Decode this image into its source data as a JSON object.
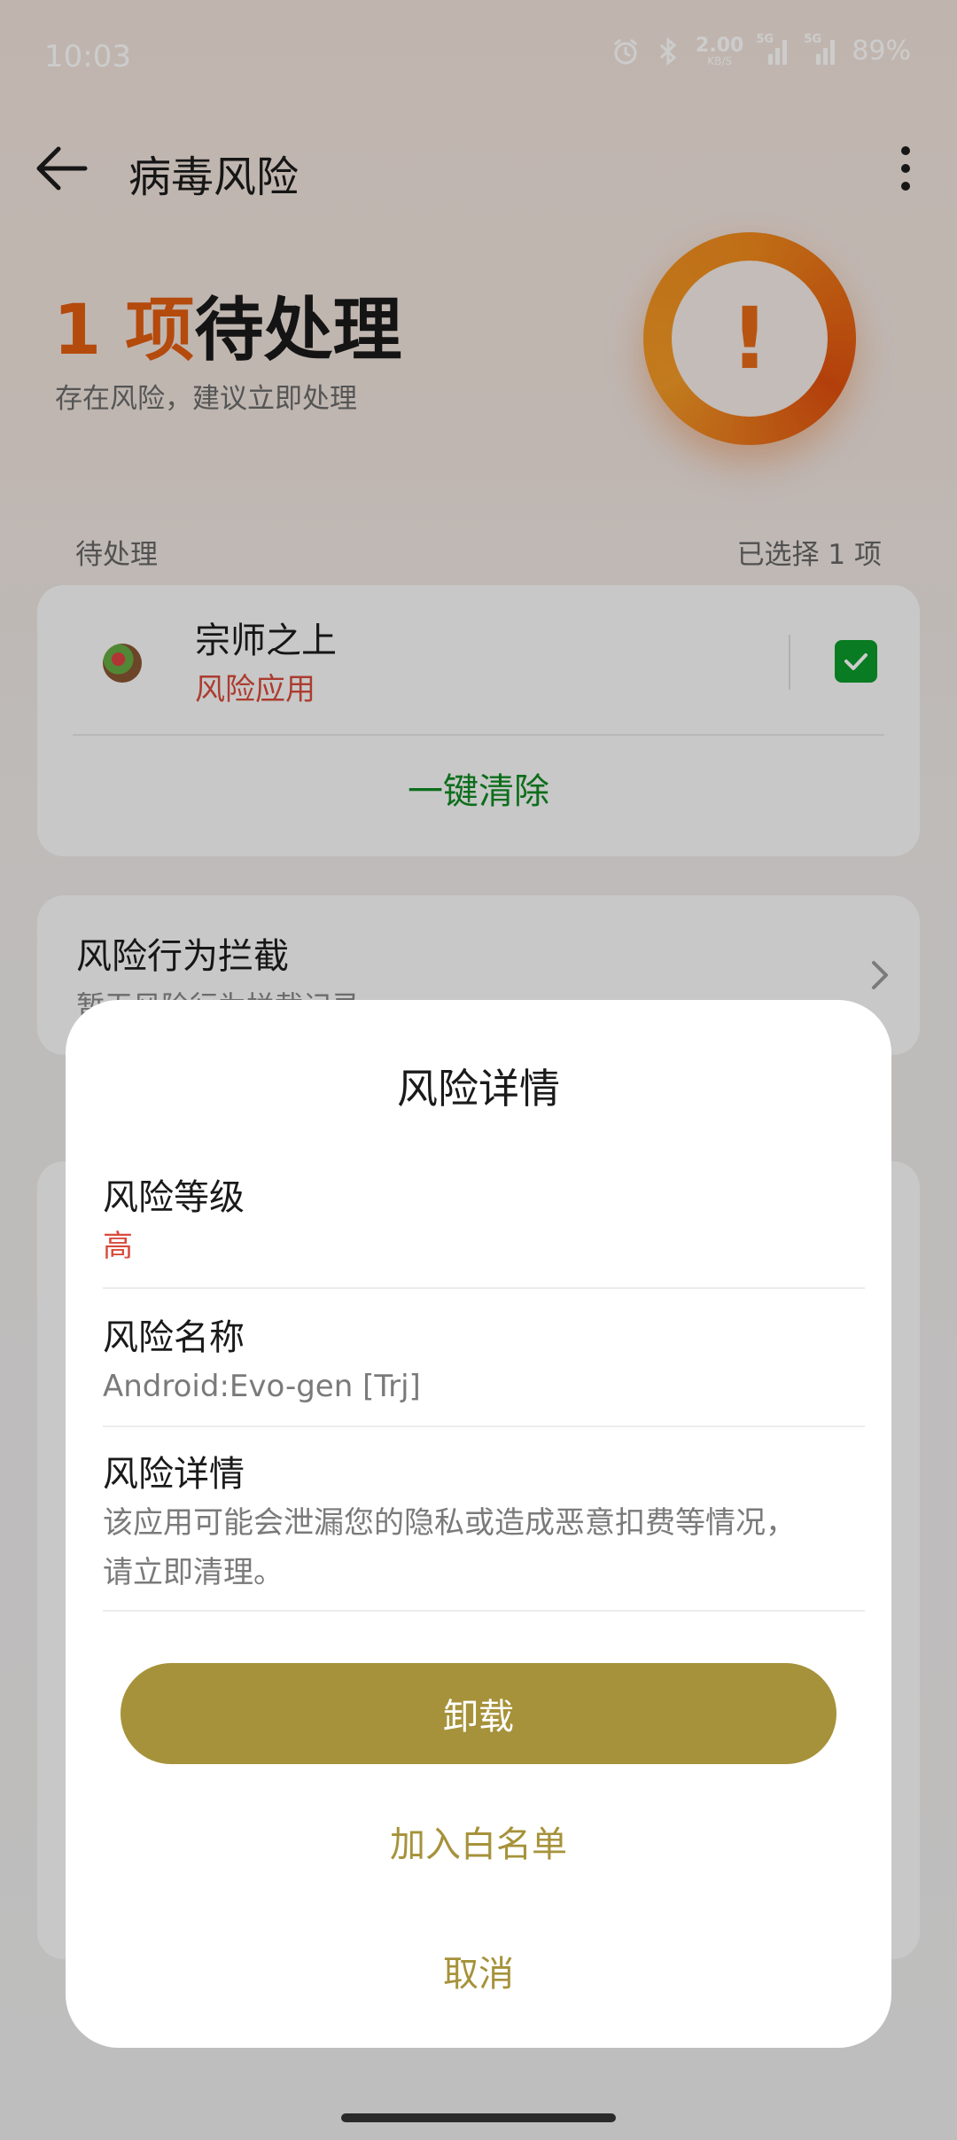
{
  "status_bar": {
    "time": "10:03",
    "net_speed_value": "2.00",
    "net_speed_unit": "KB/S",
    "network_tag_1": "5G",
    "network_tag_2": "5G",
    "battery": "89%",
    "icons": [
      "alarm-icon",
      "bluetooth-icon",
      "signal-icon",
      "signal-icon"
    ]
  },
  "header": {
    "title": "病毒风险"
  },
  "summary": {
    "count": "1 项",
    "count_suffix": "待处理",
    "subtitle": "存在风险，建议立即处理",
    "ring_mark": "!"
  },
  "pending": {
    "label": "待处理",
    "selected": "已选择 1 项",
    "items": [
      {
        "name": "宗师之上",
        "risk": "风险应用",
        "checked": true
      }
    ],
    "clear_button": "一键清除"
  },
  "behavior": {
    "title": "风险行为拦截",
    "subtitle": "暂无风险行为拦截记录"
  },
  "dialog": {
    "title": "风险详情",
    "level_label": "风险等级",
    "level_value": "高",
    "name_label": "风险名称",
    "name_value": "Android:Evo-gen [Trj]",
    "detail_label": "风险详情",
    "detail_value_line1": "该应用可能会泄漏您的隐私或造成恶意扣费等情况，",
    "detail_value_line2": "请立即清理。",
    "uninstall_button": "卸载",
    "whitelist_button": "加入白名单",
    "cancel_button": "取消"
  },
  "colors": {
    "accent_orange": "#e25d10",
    "risk_red": "#d84b3c",
    "clear_green": "#0f8a22",
    "dialog_gold": "#a6923a"
  }
}
